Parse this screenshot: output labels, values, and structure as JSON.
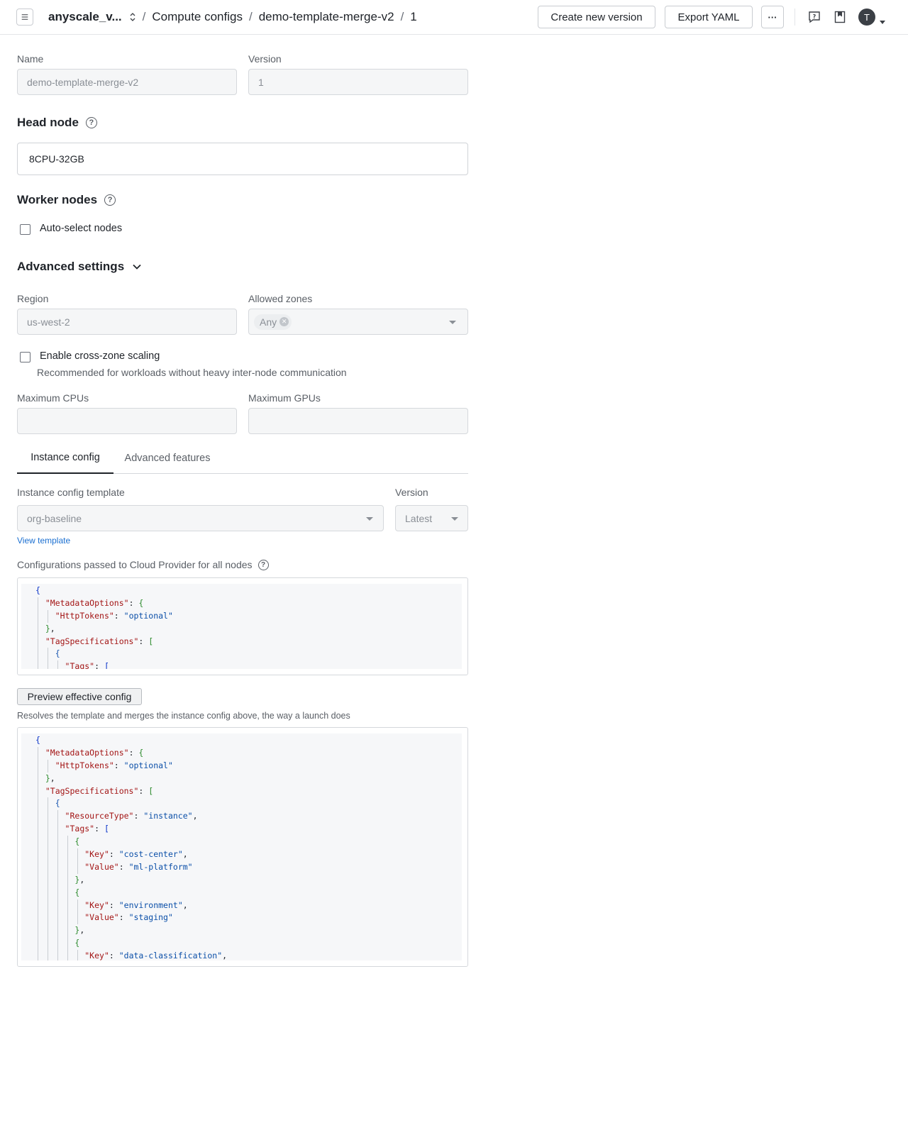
{
  "breadcrumb": {
    "project": "anyscale_v...",
    "section": "Compute configs",
    "config": "demo-template-merge-v2",
    "version": "1",
    "separator": "/"
  },
  "toolbar": {
    "create_version_label": "Create new version",
    "export_yaml_label": "Export YAML",
    "more_label": "···",
    "avatar_initial": "T",
    "icons": [
      "menu-icon",
      "sort-updown-icon",
      "help-feedback-icon",
      "bookmark-icon",
      "caret-down-icon"
    ]
  },
  "form": {
    "name_label": "Name",
    "name_value": "demo-template-merge-v2",
    "version_label": "Version",
    "version_value": "1"
  },
  "head_node": {
    "title": "Head node",
    "value": "8CPU-32GB"
  },
  "worker_nodes": {
    "title": "Worker nodes",
    "auto_select_label": "Auto-select nodes",
    "auto_select_checked": false
  },
  "advanced": {
    "title": "Advanced settings",
    "region_label": "Region",
    "region_value": "us-west-2",
    "zones_label": "Allowed zones",
    "zones_chip": "Any",
    "cross_zone_label": "Enable cross-zone scaling",
    "cross_zone_checked": false,
    "cross_zone_hint": "Recommended for workloads without heavy inter-node communication",
    "max_cpus_label": "Maximum CPUs",
    "max_cpus_value": "",
    "max_gpus_label": "Maximum GPUs",
    "max_gpus_value": ""
  },
  "tabs": {
    "instance_config": "Instance config",
    "advanced_features": "Advanced features",
    "active": "Instance config"
  },
  "instance_config": {
    "template_label": "Instance config template",
    "template_value": "org-baseline",
    "version_label": "Version",
    "version_value": "Latest",
    "view_template_link": "View template",
    "configs_label": "Configurations passed to Cloud Provider for all nodes",
    "preview_button": "Preview effective config",
    "preview_hint": "Resolves the template and merges the instance config above, the way a launch does"
  },
  "code_instance": [
    {
      "depth": 0,
      "tokens": [
        [
          "b1",
          "{"
        ]
      ]
    },
    {
      "depth": 1,
      "tokens": [
        [
          "k",
          "\"MetadataOptions\""
        ],
        [
          "p",
          ": "
        ],
        [
          "b2",
          "{"
        ]
      ]
    },
    {
      "depth": 2,
      "tokens": [
        [
          "k",
          "\"HttpTokens\""
        ],
        [
          "p",
          ": "
        ],
        [
          "s",
          "\"optional\""
        ]
      ]
    },
    {
      "depth": 1,
      "tokens": [
        [
          "b2",
          "}"
        ],
        [
          "p",
          ","
        ]
      ]
    },
    {
      "depth": 1,
      "tokens": [
        [
          "k",
          "\"TagSpecifications\""
        ],
        [
          "p",
          ": "
        ],
        [
          "b2",
          "["
        ]
      ]
    },
    {
      "depth": 2,
      "tokens": [
        [
          "b3",
          "{"
        ]
      ]
    },
    {
      "depth": 3,
      "tokens": [
        [
          "k",
          "\"Tags\""
        ],
        [
          "p",
          ": "
        ],
        [
          "b1",
          "["
        ]
      ]
    }
  ],
  "code_preview": [
    {
      "depth": 0,
      "tokens": [
        [
          "b1",
          "{"
        ]
      ]
    },
    {
      "depth": 1,
      "tokens": [
        [
          "k",
          "\"MetadataOptions\""
        ],
        [
          "p",
          ": "
        ],
        [
          "b2",
          "{"
        ]
      ]
    },
    {
      "depth": 2,
      "tokens": [
        [
          "k",
          "\"HttpTokens\""
        ],
        [
          "p",
          ": "
        ],
        [
          "s",
          "\"optional\""
        ]
      ]
    },
    {
      "depth": 1,
      "tokens": [
        [
          "b2",
          "}"
        ],
        [
          "p",
          ","
        ]
      ]
    },
    {
      "depth": 1,
      "tokens": [
        [
          "k",
          "\"TagSpecifications\""
        ],
        [
          "p",
          ": "
        ],
        [
          "b2",
          "["
        ]
      ]
    },
    {
      "depth": 2,
      "tokens": [
        [
          "b3",
          "{"
        ]
      ]
    },
    {
      "depth": 3,
      "tokens": [
        [
          "k",
          "\"ResourceType\""
        ],
        [
          "p",
          ": "
        ],
        [
          "s",
          "\"instance\""
        ],
        [
          "p",
          ","
        ]
      ]
    },
    {
      "depth": 3,
      "tokens": [
        [
          "k",
          "\"Tags\""
        ],
        [
          "p",
          ": "
        ],
        [
          "b1",
          "["
        ]
      ]
    },
    {
      "depth": 4,
      "tokens": [
        [
          "b2",
          "{"
        ]
      ]
    },
    {
      "depth": 5,
      "tokens": [
        [
          "k",
          "\"Key\""
        ],
        [
          "p",
          ": "
        ],
        [
          "s",
          "\"cost-center\""
        ],
        [
          "p",
          ","
        ]
      ]
    },
    {
      "depth": 5,
      "tokens": [
        [
          "k",
          "\"Value\""
        ],
        [
          "p",
          ": "
        ],
        [
          "s",
          "\"ml-platform\""
        ]
      ]
    },
    {
      "depth": 4,
      "tokens": [
        [
          "b2",
          "}"
        ],
        [
          "p",
          ","
        ]
      ]
    },
    {
      "depth": 4,
      "tokens": [
        [
          "b2",
          "{"
        ]
      ]
    },
    {
      "depth": 5,
      "tokens": [
        [
          "k",
          "\"Key\""
        ],
        [
          "p",
          ": "
        ],
        [
          "s",
          "\"environment\""
        ],
        [
          "p",
          ","
        ]
      ]
    },
    {
      "depth": 5,
      "tokens": [
        [
          "k",
          "\"Value\""
        ],
        [
          "p",
          ": "
        ],
        [
          "s",
          "\"staging\""
        ]
      ]
    },
    {
      "depth": 4,
      "tokens": [
        [
          "b2",
          "}"
        ],
        [
          "p",
          ","
        ]
      ]
    },
    {
      "depth": 4,
      "tokens": [
        [
          "b2",
          "{"
        ]
      ]
    },
    {
      "depth": 5,
      "tokens": [
        [
          "k",
          "\"Key\""
        ],
        [
          "p",
          ": "
        ],
        [
          "s",
          "\"data-classification\""
        ],
        [
          "p",
          ","
        ]
      ]
    }
  ]
}
